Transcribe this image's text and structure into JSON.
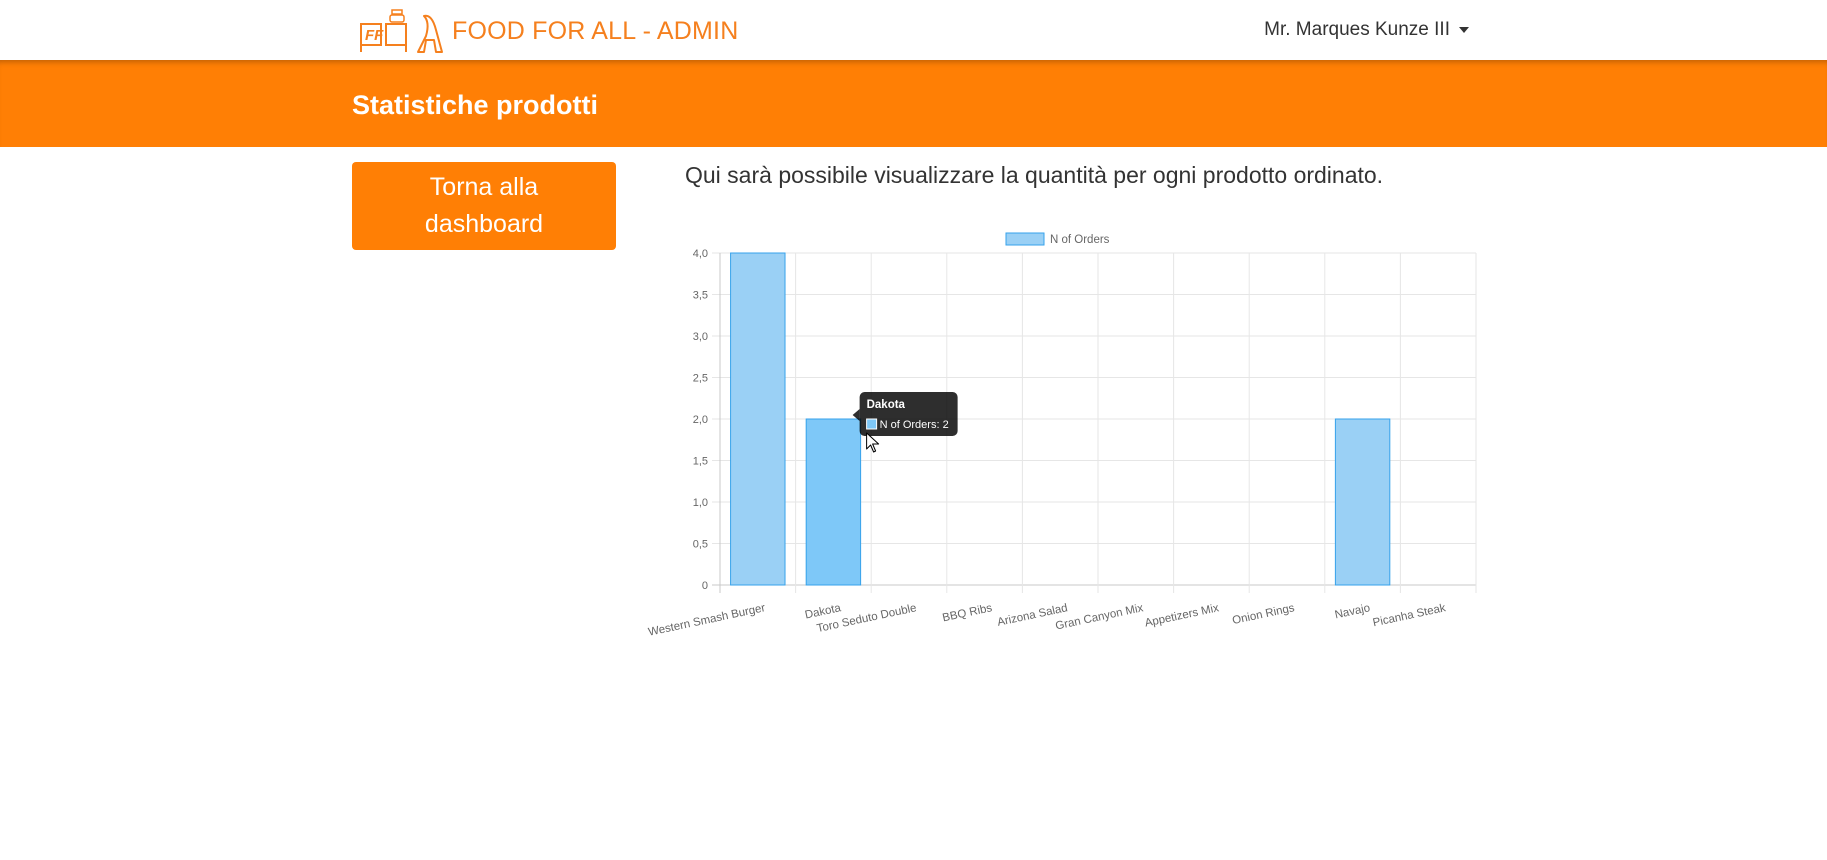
{
  "navbar": {
    "brand": "FOOD FOR ALL - ADMIN",
    "logo_letters": "FF",
    "user_name": "Mr. Marques Kunze III"
  },
  "header": {
    "title": "Statistiche prodotti"
  },
  "sidebar": {
    "back_button_label": "Torna alla dashboard"
  },
  "main": {
    "description": "Qui sarà possibile visualizzare la quantità per ogni prodotto ordinato."
  },
  "colors": {
    "accent": "#ff7f05",
    "brand_text": "#f5801e",
    "bar_fill": "#9ad0f5",
    "bar_border": "#36a2eb",
    "bar_hover": "#7ec8f8"
  },
  "chart_data": {
    "type": "bar",
    "legend_position": "top",
    "grid": true,
    "categories": [
      "Western Smash Burger",
      "Dakota",
      "Toro Seduto Double",
      "BBQ Ribs",
      "Arizona Salad",
      "Gran Canyon Mix",
      "Appetizers Mix",
      "Onion Rings",
      "Navajo",
      "Picanha Steak"
    ],
    "series": [
      {
        "name": "N of Orders",
        "values": [
          4,
          2,
          0,
          0,
          0,
          0,
          0,
          0,
          2,
          0
        ]
      }
    ],
    "ylim": [
      0,
      4
    ],
    "y_ticks": [
      "0",
      "0,5",
      "1,0",
      "1,5",
      "2,0",
      "2,5",
      "3,0",
      "3,5",
      "4,0"
    ],
    "tooltip": {
      "title": "Dakota",
      "label": "N of Orders: 2"
    }
  }
}
